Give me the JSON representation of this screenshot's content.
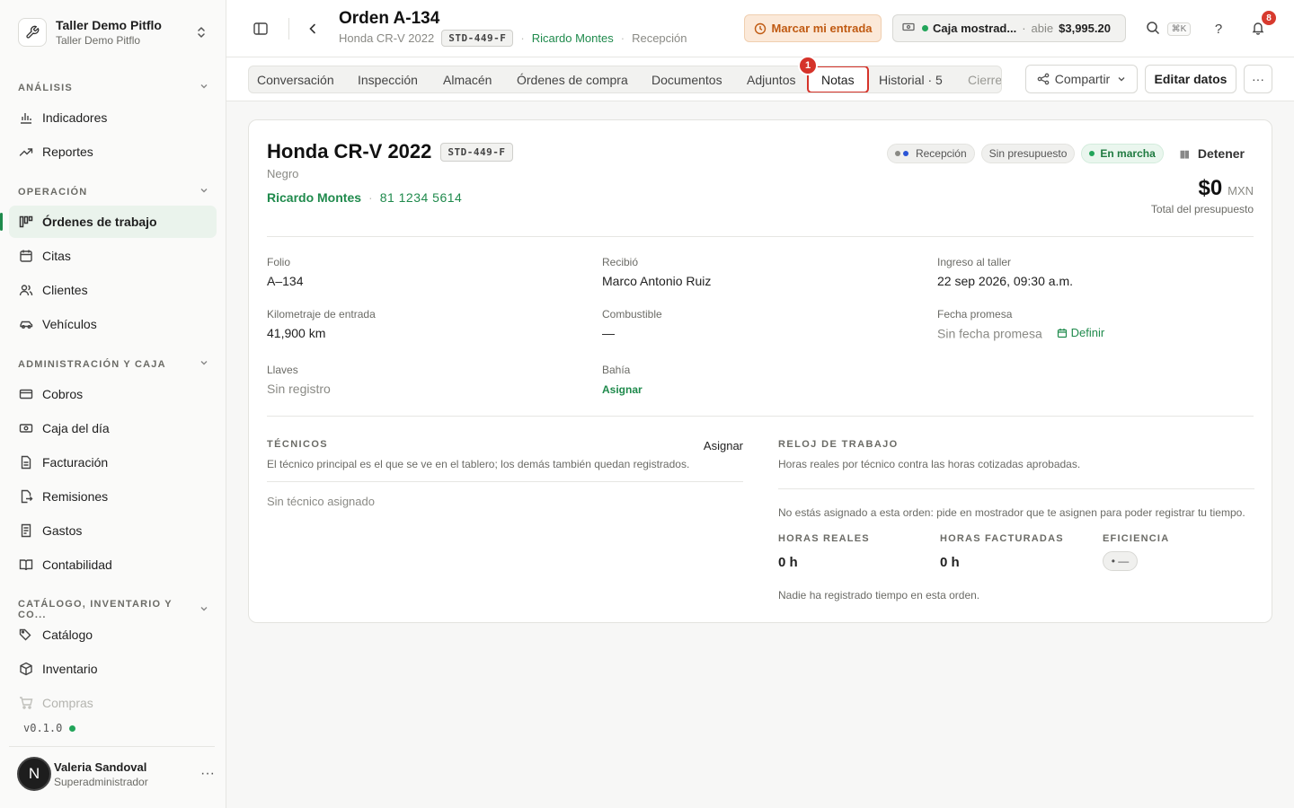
{
  "workspace": {
    "name": "Taller Demo Pitflo",
    "subtitle": "Taller Demo Pitflo"
  },
  "sidebar": {
    "sections": [
      {
        "label": "ANÁLISIS"
      },
      {
        "label": "OPERACIÓN"
      },
      {
        "label": "ADMINISTRACIÓN Y CAJA"
      },
      {
        "label": "CATÁLOGO, INVENTARIO Y CO..."
      }
    ],
    "items": [
      {
        "label": "Indicadores"
      },
      {
        "label": "Reportes"
      },
      {
        "label": "Órdenes de trabajo"
      },
      {
        "label": "Citas"
      },
      {
        "label": "Clientes"
      },
      {
        "label": "Vehículos"
      },
      {
        "label": "Cobros"
      },
      {
        "label": "Caja del día"
      },
      {
        "label": "Facturación"
      },
      {
        "label": "Remisiones"
      },
      {
        "label": "Gastos"
      },
      {
        "label": "Contabilidad"
      },
      {
        "label": "Catálogo"
      },
      {
        "label": "Inventario"
      },
      {
        "label": "Compras"
      }
    ],
    "version": "v0.1.0",
    "user": {
      "initial": "N",
      "name": "Valeria Sandoval",
      "role": "Superadministrador"
    }
  },
  "header": {
    "title": "Orden A-134",
    "vehicle": "Honda CR-V 2022",
    "plate": "STD-449-F",
    "client": "Ricardo Montes",
    "stage": "Recepción",
    "entry_button": "Marcar mi entrada",
    "caja": {
      "name": "Caja mostrad...",
      "state": "abie",
      "amount": "$3,995.20",
      "separator": "·"
    },
    "search_shortcut": "⌘K",
    "help": "?",
    "notifications_count": "8"
  },
  "tabs": {
    "items": [
      "Conversación",
      "Inspección",
      "Almacén",
      "Órdenes de compra",
      "Documentos",
      "Adjuntos",
      "Notas",
      "Historial · 5",
      "Cierre"
    ],
    "selected": "Notas",
    "marker": "1",
    "share": "Compartir",
    "edit": "Editar datos",
    "more": "···"
  },
  "vehicle_card": {
    "title": "Honda CR-V 2022",
    "plate": "STD-449-F",
    "color": "Negro",
    "owner": "Ricardo Montes",
    "phone": "81 1234 5614",
    "badges": {
      "stage": "Recepción",
      "budget": "Sin presupuesto",
      "status": "En marcha",
      "stop": "Detener"
    },
    "total": {
      "amount": "$0",
      "currency": "MXN",
      "label": "Total del presupuesto"
    }
  },
  "fields": {
    "folio": {
      "label": "Folio",
      "value": "A–134"
    },
    "recibio": {
      "label": "Recibió",
      "value": "Marco Antonio Ruiz"
    },
    "ingreso": {
      "label": "Ingreso al taller",
      "value": "22 sep 2026, 09:30 a.m."
    },
    "km": {
      "label": "Kilometraje de entrada",
      "value": "41,900 km"
    },
    "combustible": {
      "label": "Combustible",
      "value": "—"
    },
    "promesa": {
      "label": "Fecha promesa",
      "value": "Sin fecha promesa",
      "action": "Definir"
    },
    "llaves": {
      "label": "Llaves",
      "value": "Sin registro"
    },
    "bahia": {
      "label": "Bahía",
      "value": "Asignar"
    }
  },
  "tecnicos": {
    "title": "TÉCNICOS",
    "assign": "Asignar",
    "desc": "El técnico principal es el que se ve en el tablero; los demás también quedan registrados.",
    "empty": "Sin técnico asignado"
  },
  "reloj": {
    "title": "RELOJ DE TRABAJO",
    "desc": "Horas reales por técnico contra las horas cotizadas aprobadas.",
    "message": "No estás asignado a esta orden: pide en mostrador que te asignen para poder registrar tu tiempo.",
    "stats": [
      {
        "label": "HORAS REALES",
        "value": "0 h"
      },
      {
        "label": "HORAS FACTURADAS",
        "value": "0 h"
      },
      {
        "label": "EFICIENCIA",
        "value": "• —"
      }
    ],
    "footer": "Nadie ha registrado tiempo en esta orden."
  },
  "colors": {
    "accent": "#1f8a4c",
    "alert": "#d5332a",
    "entry": "#c05a12"
  }
}
